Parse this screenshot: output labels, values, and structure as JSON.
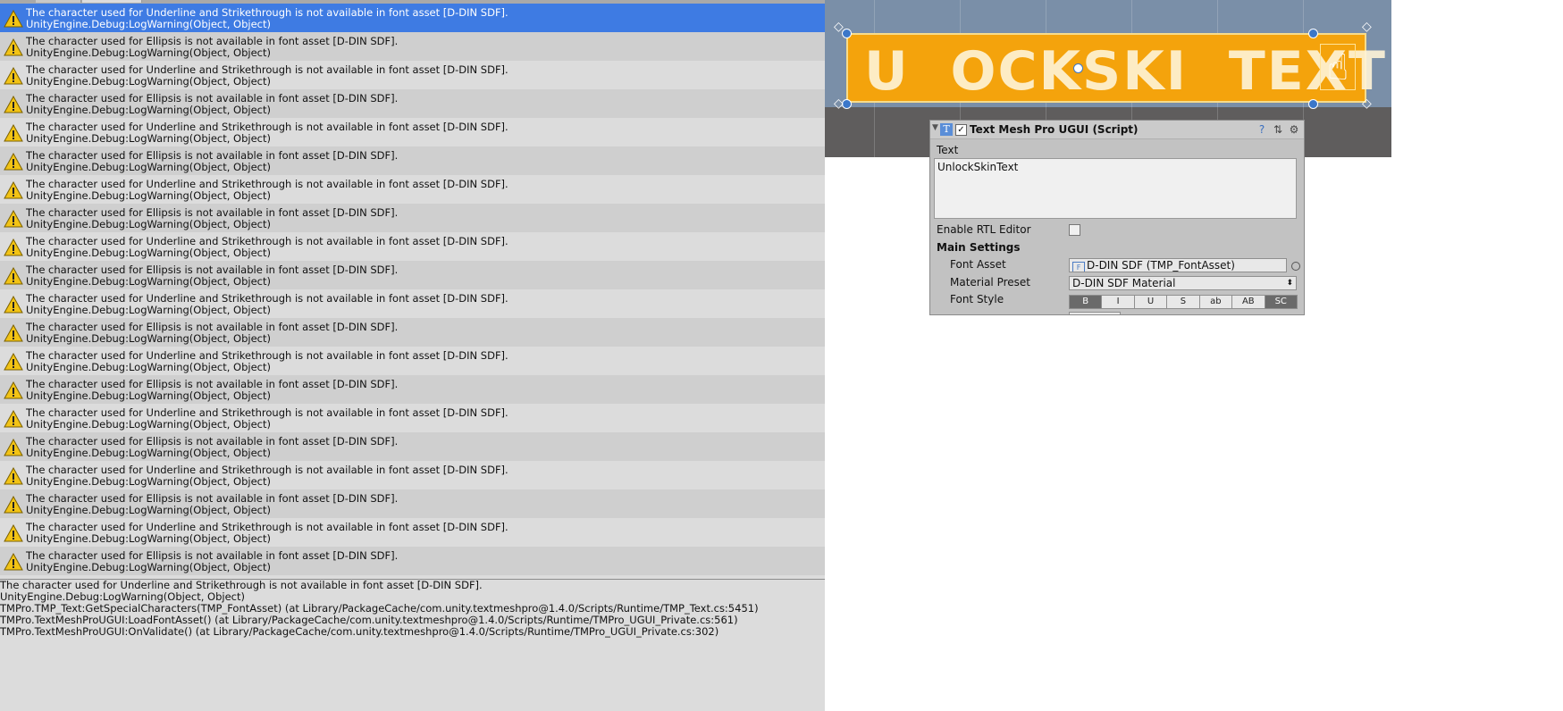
{
  "console": {
    "selected_index": 0,
    "entries": [
      {
        "line1": "The character used for Underline and Strikethrough is not available in font asset [D-DIN SDF].",
        "line2": "UnityEngine.Debug:LogWarning(Object, Object)"
      },
      {
        "line1": "The character used for Ellipsis is not available in font asset [D-DIN SDF].",
        "line2": "UnityEngine.Debug:LogWarning(Object, Object)"
      },
      {
        "line1": "The character used for Underline and Strikethrough is not available in font asset [D-DIN SDF].",
        "line2": "UnityEngine.Debug:LogWarning(Object, Object)"
      },
      {
        "line1": "The character used for Ellipsis is not available in font asset [D-DIN SDF].",
        "line2": "UnityEngine.Debug:LogWarning(Object, Object)"
      },
      {
        "line1": "The character used for Underline and Strikethrough is not available in font asset [D-DIN SDF].",
        "line2": "UnityEngine.Debug:LogWarning(Object, Object)"
      },
      {
        "line1": "The character used for Ellipsis is not available in font asset [D-DIN SDF].",
        "line2": "UnityEngine.Debug:LogWarning(Object, Object)"
      },
      {
        "line1": "The character used for Underline and Strikethrough is not available in font asset [D-DIN SDF].",
        "line2": "UnityEngine.Debug:LogWarning(Object, Object)"
      },
      {
        "line1": "The character used for Ellipsis is not available in font asset [D-DIN SDF].",
        "line2": "UnityEngine.Debug:LogWarning(Object, Object)"
      },
      {
        "line1": "The character used for Underline and Strikethrough is not available in font asset [D-DIN SDF].",
        "line2": "UnityEngine.Debug:LogWarning(Object, Object)"
      },
      {
        "line1": "The character used for Ellipsis is not available in font asset [D-DIN SDF].",
        "line2": "UnityEngine.Debug:LogWarning(Object, Object)"
      },
      {
        "line1": "The character used for Underline and Strikethrough is not available in font asset [D-DIN SDF].",
        "line2": "UnityEngine.Debug:LogWarning(Object, Object)"
      },
      {
        "line1": "The character used for Ellipsis is not available in font asset [D-DIN SDF].",
        "line2": "UnityEngine.Debug:LogWarning(Object, Object)"
      },
      {
        "line1": "The character used for Underline and Strikethrough is not available in font asset [D-DIN SDF].",
        "line2": "UnityEngine.Debug:LogWarning(Object, Object)"
      },
      {
        "line1": "The character used for Ellipsis is not available in font asset [D-DIN SDF].",
        "line2": "UnityEngine.Debug:LogWarning(Object, Object)"
      },
      {
        "line1": "The character used for Underline and Strikethrough is not available in font asset [D-DIN SDF].",
        "line2": "UnityEngine.Debug:LogWarning(Object, Object)"
      },
      {
        "line1": "The character used for Ellipsis is not available in font asset [D-DIN SDF].",
        "line2": "UnityEngine.Debug:LogWarning(Object, Object)"
      },
      {
        "line1": "The character used for Underline and Strikethrough is not available in font asset [D-DIN SDF].",
        "line2": "UnityEngine.Debug:LogWarning(Object, Object)"
      },
      {
        "line1": "The character used for Ellipsis is not available in font asset [D-DIN SDF].",
        "line2": "UnityEngine.Debug:LogWarning(Object, Object)"
      },
      {
        "line1": "The character used for Underline and Strikethrough is not available in font asset [D-DIN SDF].",
        "line2": "UnityEngine.Debug:LogWarning(Object, Object)"
      },
      {
        "line1": "The character used for Ellipsis is not available in font asset [D-DIN SDF].",
        "line2": "UnityEngine.Debug:LogWarning(Object, Object)"
      }
    ],
    "stack_trace": [
      "The character used for Underline and Strikethrough is not available in font asset [D-DIN SDF].",
      "UnityEngine.Debug:LogWarning(Object, Object)",
      "TMPro.TMP_Text:GetSpecialCharacters(TMP_FontAsset) (at Library/PackageCache/com.unity.textmeshpro@1.4.0/Scripts/Runtime/TMP_Text.cs:5451)",
      "TMPro.TextMeshProUGUI:LoadFontAsset() (at Library/PackageCache/com.unity.textmeshpro@1.4.0/Scripts/Runtime/TMPro_UGUI_Private.cs:561)",
      "TMPro.TextMeshProUGUI:OnValidate() (at Library/PackageCache/com.unity.textmeshpro@1.4.0/Scripts/Runtime/TMPro_UGUI_Private.cs:302)"
    ],
    "icon": "warning-icon"
  },
  "scene": {
    "button_text": "U  OCKSKI  TEXT",
    "button_color": "#f4a30c",
    "icon": "hand-cursor-icon"
  },
  "inspector": {
    "component_title": "Text Mesh Pro UGUI (Script)",
    "enabled": true,
    "text_label": "Text",
    "text_value": "UnlockSkinText",
    "rtl_label": "Enable RTL Editor",
    "rtl_checked": false,
    "main_settings_label": "Main Settings",
    "font_asset_label": "Font Asset",
    "font_asset_value": "D-DIN SDF (TMP_FontAsset)",
    "material_preset_label": "Material Preset",
    "material_preset_value": "D-DIN SDF Material",
    "font_style_label": "Font Style",
    "font_style_buttons": [
      {
        "label": "B",
        "on": true
      },
      {
        "label": "I",
        "on": false
      },
      {
        "label": "U",
        "on": false
      },
      {
        "label": "S",
        "on": false
      },
      {
        "label": "ab",
        "on": false
      },
      {
        "label": "AB",
        "on": false
      },
      {
        "label": "SC",
        "on": true
      }
    ],
    "header_icons": [
      "help-icon",
      "preset-icon",
      "gear-icon"
    ]
  }
}
